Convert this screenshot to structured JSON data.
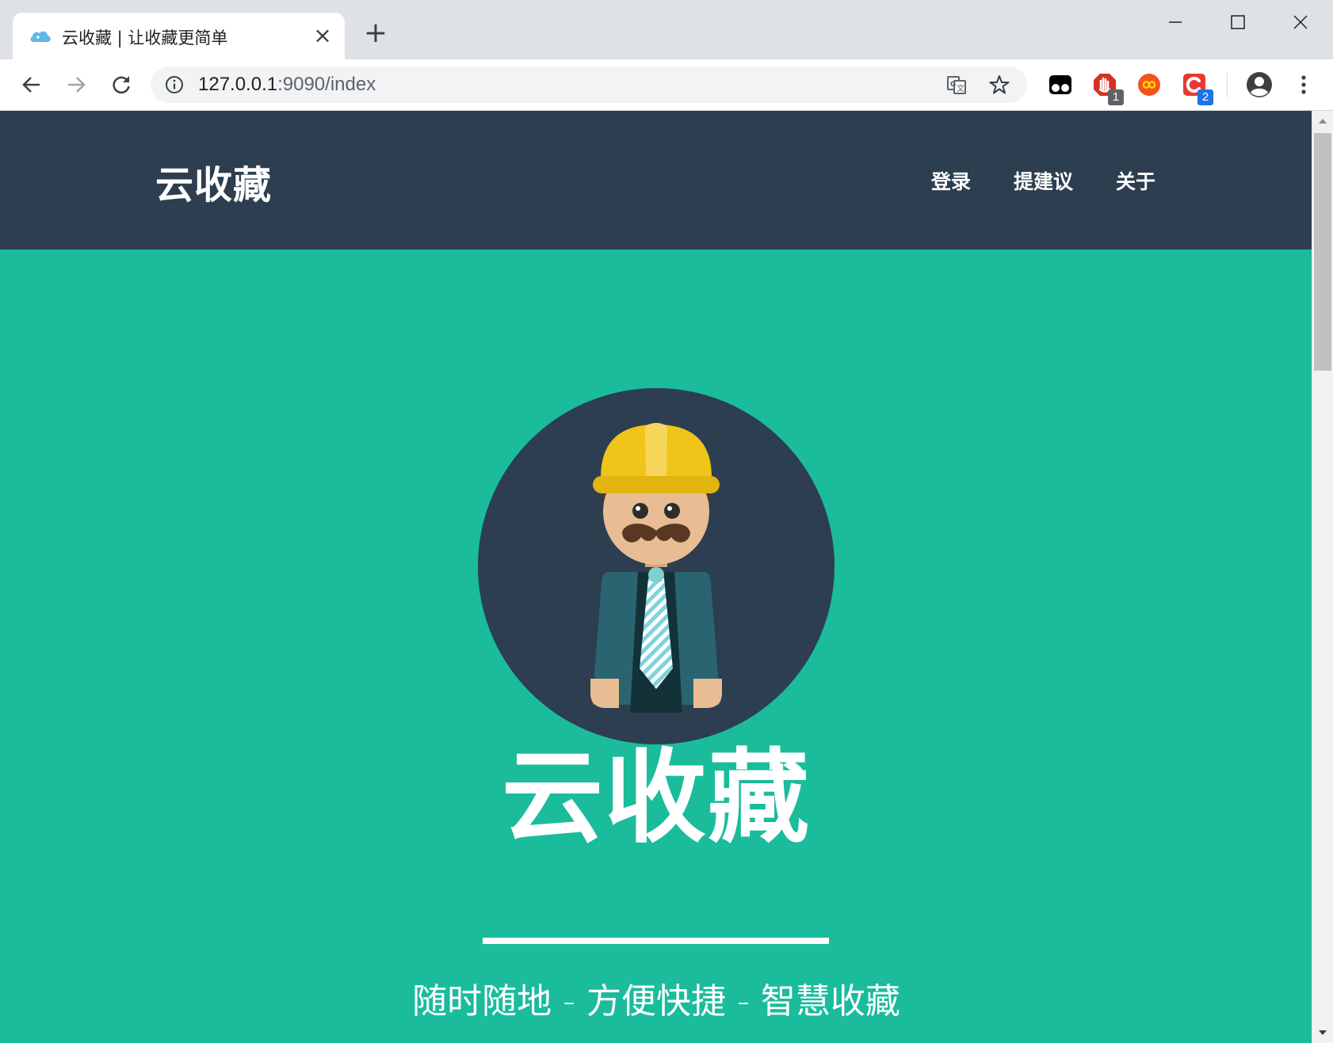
{
  "browser": {
    "tab": {
      "title": "云收藏 | 让收藏更简单",
      "close_glyph": "×",
      "favicon": "cloud-icon"
    },
    "new_tab_glyph": "+",
    "address": {
      "host": "127.0.0.1",
      "path": ":9090/index"
    },
    "extensions": [
      {
        "name": "tampermonkey-icon"
      },
      {
        "name": "adblock-icon",
        "badge": "1",
        "badge_color": "#5f6368"
      },
      {
        "name": "infinity-icon"
      },
      {
        "name": "c-extension-icon",
        "badge": "2",
        "badge_color": "#1a73e8"
      }
    ]
  },
  "site": {
    "brand": "云收藏",
    "nav": [
      {
        "label": "登录"
      },
      {
        "label": "提建议"
      },
      {
        "label": "关于"
      }
    ],
    "hero": {
      "title": "云收藏",
      "subtitle": "随时随地 - 方便快捷 - 智慧收藏",
      "avatar": "worker-avatar-illustration"
    }
  },
  "colors": {
    "nav_bg": "#2c3e50",
    "hero_bg": "#1abc9c",
    "avatar_bg": "#2c3e50",
    "text": "#ffffff"
  }
}
